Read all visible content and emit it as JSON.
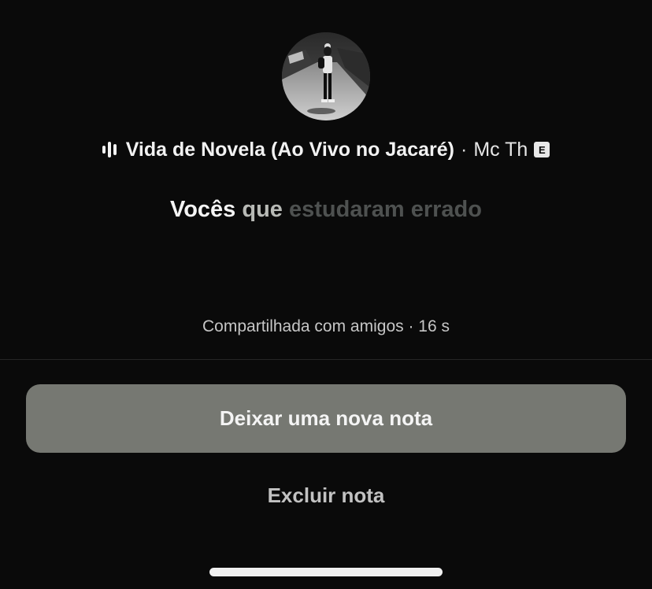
{
  "profile": {
    "avatar_icon": "person-photo-avatar"
  },
  "song": {
    "icon": "audio-wave-icon",
    "title": "Vida de Novela (Ao Vivo no Jacaré)",
    "separator": "·",
    "artist": "Mc Th",
    "explicit_badge": "E"
  },
  "lyrics": {
    "sung": "Vocês",
    "current": "que",
    "upcoming": "estudaram errado"
  },
  "note_meta": {
    "text": "Compartilhada com amigos · 16 s"
  },
  "actions": {
    "primary_label": "Deixar uma nova nota",
    "secondary_label": "Excluir nota"
  },
  "colors": {
    "background": "#0a0a0a",
    "primary_button": "#767872",
    "lyric_upcoming": "#4e5150"
  }
}
